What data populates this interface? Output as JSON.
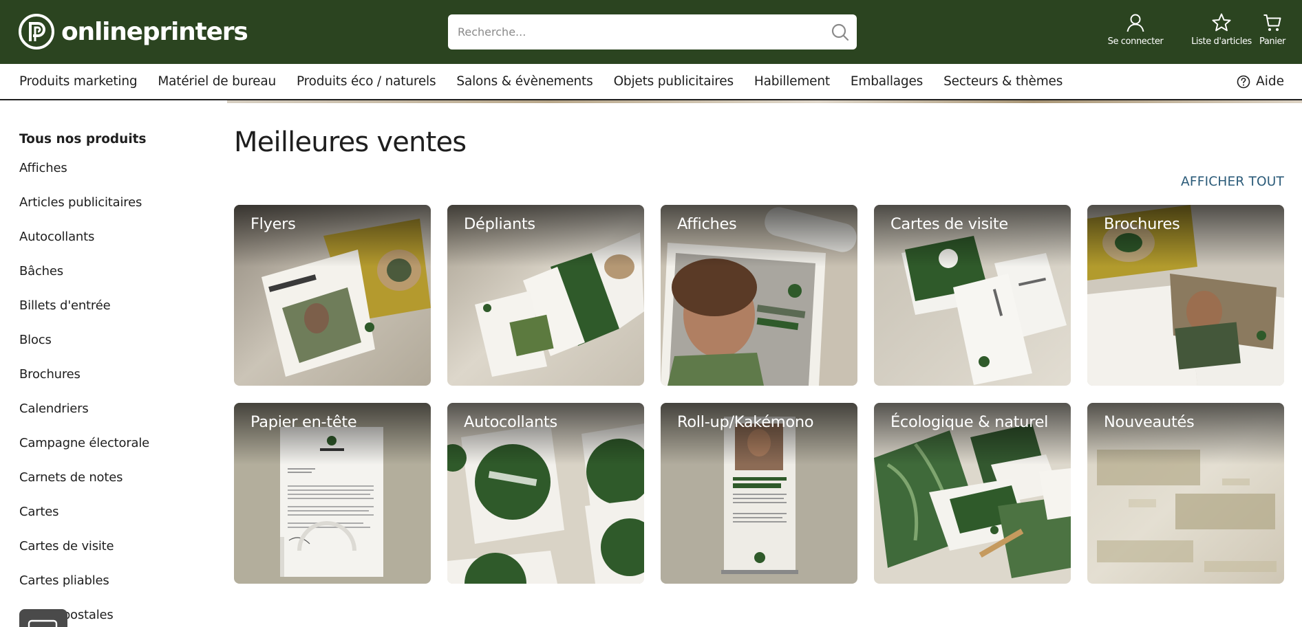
{
  "brand": {
    "name": "onlineprinters"
  },
  "search": {
    "placeholder": "Recherche..."
  },
  "header_actions": {
    "login": "Se connecter",
    "wishlist": "Liste d'articles",
    "cart": "Panier"
  },
  "nav": {
    "items": [
      "Produits marketing",
      "Matériel de bureau",
      "Produits éco / naturels",
      "Salons & évènements",
      "Objets publicitaires",
      "Habillement",
      "Emballages",
      "Secteurs & thèmes"
    ],
    "help": "Aide"
  },
  "sidebar": {
    "title": "Tous nos produits",
    "items": [
      "Affiches",
      "Articles publicitaires",
      "Autocollants",
      "Bâches",
      "Billets d'entrée",
      "Blocs",
      "Brochures",
      "Calendriers",
      "Campagne électorale",
      "Carnets de notes",
      "Cartes",
      "Cartes de visite",
      "Cartes pliables",
      "Cartes postales"
    ]
  },
  "main": {
    "title": "Meilleures ventes",
    "view_all": "Afficher tout",
    "cards": [
      "Flyers",
      "Dépliants",
      "Affiches",
      "Cartes de visite",
      "Brochures",
      "Papier en-tête",
      "Autocollants",
      "Roll-up/Kakémono",
      "Écologique & naturel",
      "Nouveautés"
    ]
  },
  "colors": {
    "header_bg": "#2b4420",
    "brand_green": "#2f5a2a",
    "link": "#2a5a78"
  }
}
